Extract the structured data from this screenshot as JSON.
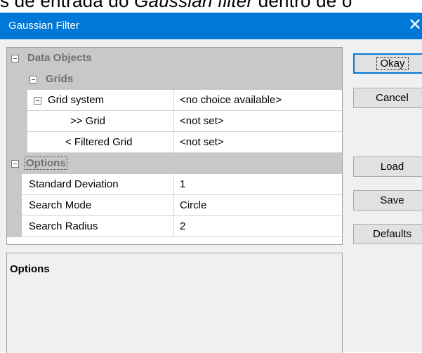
{
  "caption": {
    "before": "s de entrada do ",
    "italic": "Gaussian filter",
    "after": " dentro de o"
  },
  "window": {
    "title": "Gaussian Filter",
    "close_glyph": "✕"
  },
  "grid": {
    "data_objects": "Data Objects",
    "grids": "Grids",
    "grid_system": {
      "name": "Grid system",
      "value": "<no choice available>"
    },
    "grid": {
      "name": ">> Grid",
      "value": "<not set>"
    },
    "filtered_grid": {
      "name": "< Filtered Grid",
      "value": "<not set>"
    },
    "options": "Options",
    "standard_deviation": {
      "name": "Standard Deviation",
      "value": "1"
    },
    "search_mode": {
      "name": "Search Mode",
      "value": "Circle"
    },
    "search_radius": {
      "name": "Search Radius",
      "value": "2"
    }
  },
  "description": {
    "title": "Options"
  },
  "buttons": {
    "okay": "Okay",
    "cancel": "Cancel",
    "load": "Load",
    "save": "Save",
    "defaults": "Defaults"
  }
}
